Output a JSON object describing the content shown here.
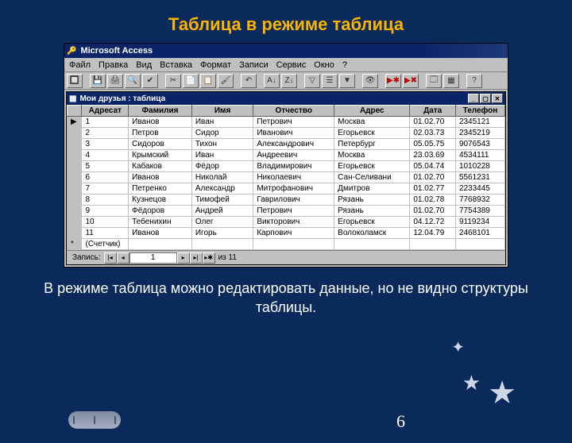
{
  "slide": {
    "title": "Таблица в режиме таблица",
    "body_text": "В режиме таблица можно редактировать данные, но не видно структуры таблицы.",
    "page_number": "6"
  },
  "app": {
    "title": "Microsoft Access",
    "menubar": [
      "Файл",
      "Правка",
      "Вид",
      "Вставка",
      "Формат",
      "Записи",
      "Сервис",
      "Окно",
      "?"
    ]
  },
  "child_window": {
    "title": "Мои друзья : таблица"
  },
  "table": {
    "columns": [
      "Адресат",
      "Фамилия",
      "Имя",
      "Отчество",
      "Адрес",
      "Дата",
      "Телефон"
    ],
    "counter_label": "(Счетчик)",
    "rows": [
      {
        "id": "1",
        "ln": "Иванов",
        "fn": "Иван",
        "mn": "Петрович",
        "addr": "Москва",
        "date": "01.02.70",
        "tel": "2345121"
      },
      {
        "id": "2",
        "ln": "Петров",
        "fn": "Сидор",
        "mn": "Иванович",
        "addr": "Егорьевск",
        "date": "02.03.73",
        "tel": "2345219"
      },
      {
        "id": "3",
        "ln": "Сидоров",
        "fn": "Тихон",
        "mn": "Александрович",
        "addr": "Петербург",
        "date": "05.05.75",
        "tel": "9076543"
      },
      {
        "id": "4",
        "ln": "Крымский",
        "fn": "Иван",
        "mn": "Андреевич",
        "addr": "Москва",
        "date": "23.03.69",
        "tel": "4534111"
      },
      {
        "id": "5",
        "ln": "Кабаков",
        "fn": "Фёдор",
        "mn": "Владимирович",
        "addr": "Егорьевск",
        "date": "05.04.74",
        "tel": "1010228"
      },
      {
        "id": "6",
        "ln": "Иванов",
        "fn": "Николай",
        "mn": "Николаевич",
        "addr": "Сан-Селивани",
        "date": "01.02.70",
        "tel": "5561231"
      },
      {
        "id": "7",
        "ln": "Петренко",
        "fn": "Александр",
        "mn": "Митрофанович",
        "addr": "Дмитров",
        "date": "01.02.77",
        "tel": "2233445"
      },
      {
        "id": "8",
        "ln": "Кузнецов",
        "fn": "Тимофей",
        "mn": "Гаврилович",
        "addr": "Рязань",
        "date": "01.02.78",
        "tel": "7768932"
      },
      {
        "id": "9",
        "ln": "Фёдоров",
        "fn": "Андрей",
        "mn": "Петрович",
        "addr": "Рязань",
        "date": "01.02.70",
        "tel": "7754389"
      },
      {
        "id": "10",
        "ln": "Тебенихин",
        "fn": "Олег",
        "mn": "Викторович",
        "addr": "Егорьевск",
        "date": "04.12.72",
        "tel": "9119234"
      },
      {
        "id": "11",
        "ln": "Иванов",
        "fn": "Игорь",
        "mn": "Карпович",
        "addr": "Волоколамск",
        "date": "12.04.79",
        "tel": "2468101"
      }
    ]
  },
  "nav": {
    "label": "Запись:",
    "current": "1",
    "of_label": "из 11"
  }
}
